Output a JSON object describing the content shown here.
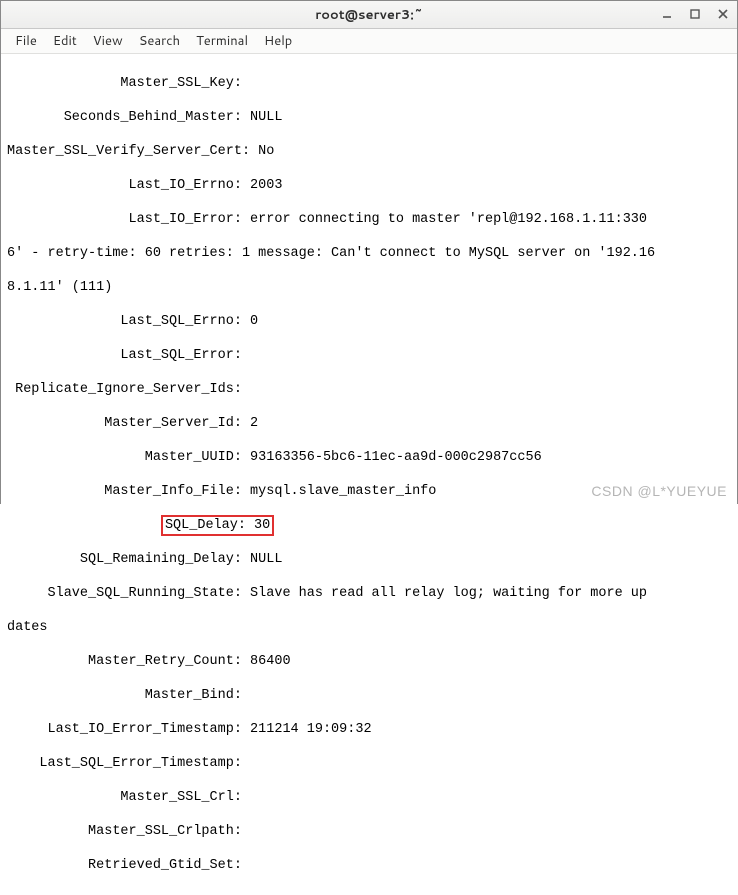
{
  "window": {
    "title": "root@server3:~"
  },
  "menubar": {
    "file": "File",
    "edit": "Edit",
    "view": "View",
    "search": "Search",
    "terminal": "Terminal",
    "help": "Help"
  },
  "lines": {
    "l01": "              Master_SSL_Key: ",
    "l02": "       Seconds_Behind_Master: NULL",
    "l03": "Master_SSL_Verify_Server_Cert: No",
    "l04": "               Last_IO_Errno: 2003",
    "l05": "               Last_IO_Error: error connecting to master 'repl@192.168.1.11:330",
    "l06": "6' - retry-time: 60 retries: 1 message: Can't connect to MySQL server on '192.16",
    "l07": "8.1.11' (111)",
    "l08": "              Last_SQL_Errno: 0",
    "l09": "              Last_SQL_Error: ",
    "l10": " Replicate_Ignore_Server_Ids: ",
    "l11": "            Master_Server_Id: 2",
    "l12": "                 Master_UUID: 93163356-5bc6-11ec-aa9d-000c2987cc56",
    "l13": "            Master_Info_File: mysql.slave_master_info",
    "l14a": "                   ",
    "l14b": "SQL_Delay: 30",
    "l15": "         SQL_Remaining_Delay: NULL",
    "l16": "     Slave_SQL_Running_State: Slave has read all relay log; waiting for more up",
    "l17": "dates",
    "l18": "          Master_Retry_Count: 86400",
    "l19": "                 Master_Bind: ",
    "l20": "     Last_IO_Error_Timestamp: 211214 19:09:32",
    "l21": "    Last_SQL_Error_Timestamp: ",
    "l22": "              Master_SSL_Crl: ",
    "l23": "          Master_SSL_Crlpath: ",
    "l24": "          Retrieved_Gtid_Set: "
  },
  "watermark": "CSDN @L*YUEYUE"
}
